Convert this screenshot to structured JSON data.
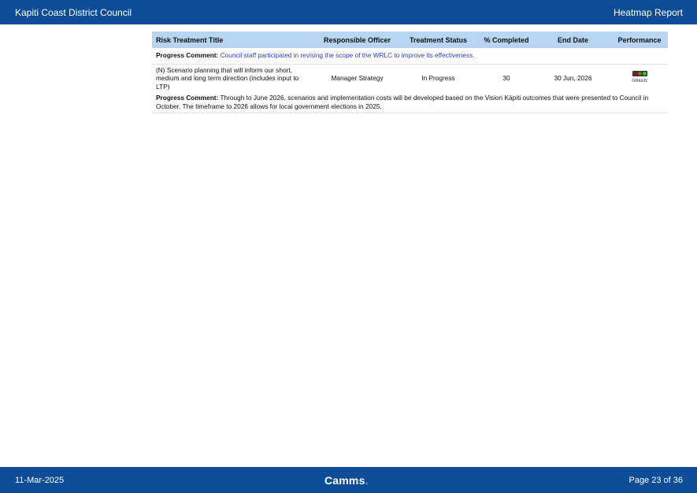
{
  "header": {
    "org": "Kapiti Coast District Council",
    "report": "Heatmap Report"
  },
  "table": {
    "columns": [
      "Risk Treatment Title",
      "Responsible Officer",
      "Treatment Status",
      "% Completed",
      "End Date",
      "Performance"
    ],
    "comment1": {
      "label": "Progress Comment:",
      "text": "Council staff participated in revising the scope of the WRLC to improve its effectiveness."
    },
    "row": {
      "title": "(N) Scenario planning that will inform our short, medium and long term direction (includes input to LTP)",
      "officer": "Manager Strategy",
      "status": "In Progress",
      "completed": "30",
      "end_date": "30 Jun, 2026",
      "performance": "GREEN",
      "lights": [
        "#8a1a1a",
        "#7a6a10",
        "#2fbf3a"
      ]
    },
    "comment2": {
      "label": "Progress Comment:",
      "text": "Through to June 2026, scenarios and implementation costs will be developed based on the Vision Kāpiti outcomes that were presented to Council in October. The timeframe to 2026 allows for local government elections in 2025."
    }
  },
  "footer": {
    "date": "11-Mar-2025",
    "brand": "Camms",
    "brand_dot": ".",
    "page": "Page 23 of 36"
  },
  "colors": {
    "bar": "#0d4c97",
    "header_row": "#b7d5f0",
    "comment_link": "#2a3fd2"
  }
}
